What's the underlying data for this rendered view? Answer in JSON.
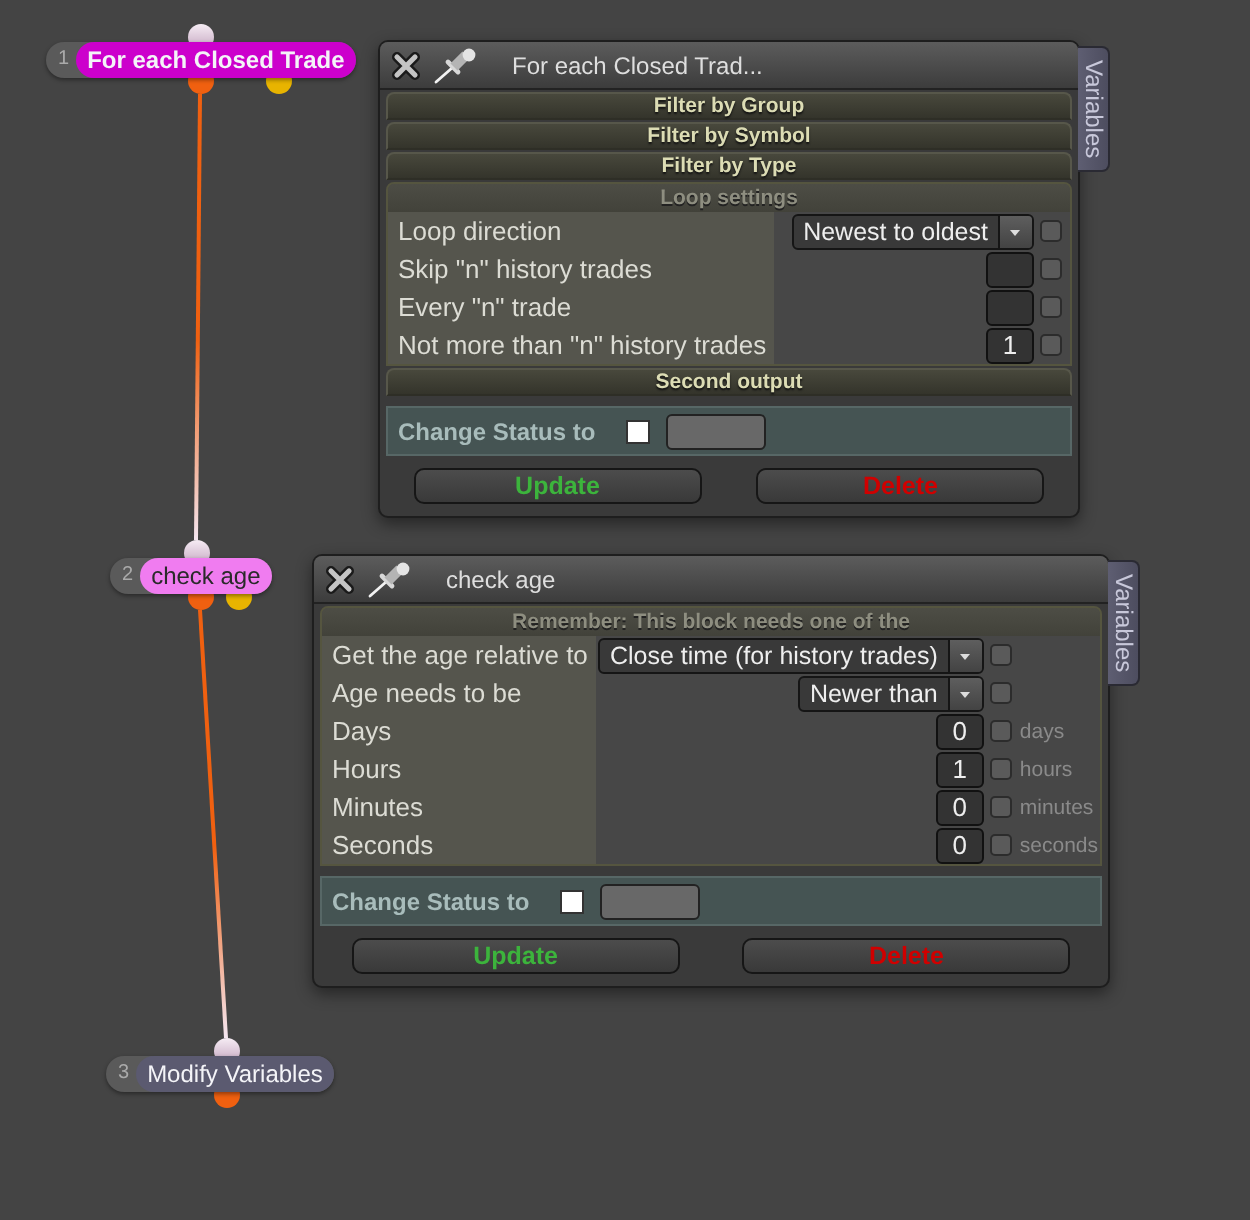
{
  "nodes": [
    {
      "number": "1",
      "label": "For each Closed Trade",
      "color": "#cc00cc",
      "selected": true,
      "outputs": [
        {
          "color": "#f06010"
        },
        {
          "color": "#e8b400"
        }
      ]
    },
    {
      "number": "2",
      "label": "check age",
      "color": "#f07cf0",
      "selected": false,
      "outputs": [
        {
          "color": "#f06010"
        },
        {
          "color": "#e8b400"
        }
      ]
    },
    {
      "number": "3",
      "label": "Modify Variables",
      "color": "#5b5a70",
      "selected": false,
      "outputs": [
        {
          "color": "#f06010"
        }
      ]
    }
  ],
  "panels": [
    {
      "title": "For each Closed Trad...",
      "side_tab": "Variables",
      "sections": [
        {
          "title": "Filter by Group",
          "expanded": false
        },
        {
          "title": "Filter by Symbol",
          "expanded": false
        },
        {
          "title": "Filter by Type",
          "expanded": false
        },
        {
          "title": "Loop settings",
          "expanded": true,
          "rows": [
            {
              "label": "Loop direction",
              "control": {
                "kind": "dropdown",
                "value": "Newest to oldest"
              },
              "checked": false
            },
            {
              "label": "Skip \"n\" history trades",
              "control": {
                "kind": "number"
              },
              "checked": false
            },
            {
              "label": "Every \"n\" trade",
              "control": {
                "kind": "number"
              },
              "checked": false
            },
            {
              "label": "Not more than \"n\" history trades",
              "control": {
                "kind": "number",
                "value": "1"
              },
              "checked": false
            }
          ]
        },
        {
          "title": "Second output",
          "expanded": false
        }
      ],
      "status": {
        "label": "Change Status to",
        "checked": false
      },
      "buttons": [
        {
          "label": "Update",
          "kind": "update"
        },
        {
          "label": "Delete",
          "kind": "delete"
        }
      ]
    },
    {
      "title": "check age",
      "side_tab": "Variables",
      "sections": [
        {
          "title": "Remember: This block needs one of the",
          "expanded": true,
          "rows": [
            {
              "label": "Get the age relative to",
              "control": {
                "kind": "dropdown",
                "value": "Close time (for history trades)"
              },
              "checked": false
            },
            {
              "label": "Age needs to be",
              "control": {
                "kind": "dropdown",
                "value": "Newer than"
              },
              "checked": false
            },
            {
              "label": "Days",
              "control": {
                "kind": "number",
                "value": "0"
              },
              "checked": false,
              "unit": "days"
            },
            {
              "label": "Hours",
              "control": {
                "kind": "number",
                "value": "1"
              },
              "checked": false,
              "unit": "hours"
            },
            {
              "label": "Minutes",
              "control": {
                "kind": "number",
                "value": "0"
              },
              "checked": false,
              "unit": "minutes"
            },
            {
              "label": "Seconds",
              "control": {
                "kind": "number",
                "value": "0"
              },
              "checked": false,
              "unit": "seconds"
            }
          ]
        }
      ],
      "status": {
        "label": "Change Status to",
        "checked": false
      },
      "buttons": [
        {
          "label": "Update",
          "kind": "update"
        },
        {
          "label": "Delete",
          "kind": "delete"
        }
      ]
    }
  ]
}
